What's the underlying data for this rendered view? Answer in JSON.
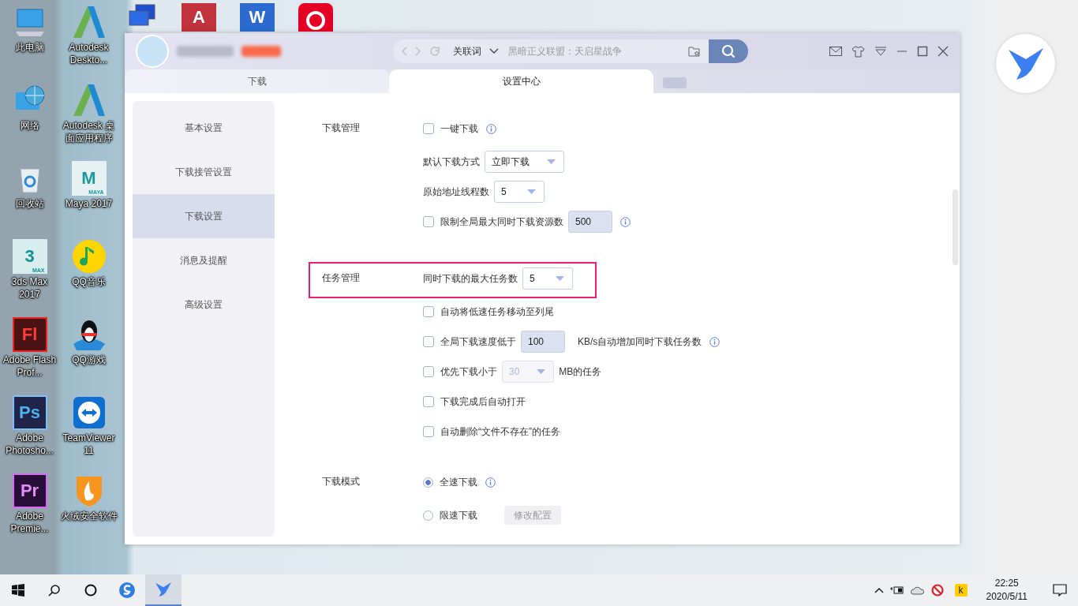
{
  "desktop": {
    "top_icons": [
      {
        "kind": "network"
      },
      {
        "kind": "access",
        "glyph": "A"
      },
      {
        "kind": "word",
        "glyph": "W"
      },
      {
        "kind": "netease"
      }
    ],
    "columns": [
      [
        {
          "kind": "pc",
          "label": "此电脑"
        },
        {
          "kind": "globe",
          "label": "网络"
        },
        {
          "kind": "recycle",
          "label": "回收站"
        },
        {
          "kind": "max",
          "glyph": "3",
          "badge": "MAX",
          "label": "3ds Max 2017"
        },
        {
          "kind": "flash",
          "glyph": "Fl",
          "label": "Adobe Flash Prof..."
        },
        {
          "kind": "photoshop",
          "glyph": "Ps",
          "label": "Adobe Photosho..."
        },
        {
          "kind": "premiere",
          "glyph": "Pr",
          "label": "Adobe Premie..."
        }
      ],
      [
        {
          "kind": "autodesk",
          "label": "Autodesk Deskto..."
        },
        {
          "kind": "autodesk",
          "label": "Autodesk 桌面应用程序"
        },
        {
          "kind": "maya",
          "glyph": "M",
          "badge": "MAYA",
          "label": "Maya 2017"
        },
        {
          "kind": "qqmusic",
          "label": "QQ音乐"
        },
        {
          "kind": "qqgame",
          "label": "QQ游戏"
        },
        {
          "kind": "teamviewer",
          "label": "TeamViewer 11"
        },
        {
          "kind": "huorong",
          "label": "火绒安全软件"
        }
      ]
    ]
  },
  "window": {
    "search": {
      "scope": "关联词",
      "placeholder": "黑暗正义联盟：天启星战争"
    },
    "tabs": [
      {
        "label": "下载",
        "selected": false
      },
      {
        "label": "设置中心",
        "selected": true
      }
    ],
    "sidebar": [
      {
        "label": "基本设置",
        "selected": false
      },
      {
        "label": "下载接管设置",
        "selected": false
      },
      {
        "label": "下载设置",
        "selected": true
      },
      {
        "label": "消息及提醒",
        "selected": false
      },
      {
        "label": "高级设置",
        "selected": false
      }
    ],
    "sections": [
      {
        "title": "下载管理",
        "highlighted": false,
        "rows": [
          {
            "kind": "checkbox",
            "label": "一键下载",
            "checked": false,
            "info": true
          },
          {
            "kind": "select",
            "label": "默认下载方式",
            "value": "立即下载",
            "disabled": false
          },
          {
            "kind": "select",
            "label": "原始地址线程数",
            "value": "5",
            "disabled": false
          },
          {
            "kind": "checkbox_input",
            "label": "限制全局最大同时下载资源数",
            "checked": false,
            "value": "500",
            "info": true
          }
        ]
      },
      {
        "title": "任务管理",
        "highlighted": true,
        "rows": [
          {
            "kind": "select",
            "label": "同时下载的最大任务数",
            "value": "5",
            "disabled": false
          },
          {
            "kind": "checkbox",
            "label": "自动将低速任务移动至列尾",
            "checked": false,
            "info": false
          },
          {
            "kind": "checkbox_input",
            "label": "全局下载速度低于",
            "checked": false,
            "value": "100",
            "suffix": "KB/s自动增加同时下载任务数",
            "info": true
          },
          {
            "kind": "checkbox_select",
            "label": "优先下载小于",
            "checked": false,
            "value": "30",
            "disabled": true,
            "suffix": "MB的任务"
          },
          {
            "kind": "checkbox",
            "label": "下载完成后自动打开",
            "checked": false,
            "info": false
          },
          {
            "kind": "checkbox",
            "label": "自动删除“文件不存在”的任务",
            "checked": false,
            "info": false
          }
        ]
      },
      {
        "title": "下载模式",
        "highlighted": false,
        "rows": [
          {
            "kind": "radio",
            "label": "全速下载",
            "selected": true,
            "info": true
          },
          {
            "kind": "radio",
            "label": "限速下载",
            "selected": false,
            "info": false,
            "button": {
              "label": "修改配置",
              "disabled": true
            }
          }
        ]
      }
    ]
  },
  "taskbar": {
    "apps": [
      {
        "kind": "sogou",
        "selected": false
      },
      {
        "kind": "bird",
        "selected": true
      }
    ],
    "tray": {
      "k_glyph": "k",
      "time": "22:25",
      "date": "2020/5/11"
    }
  }
}
